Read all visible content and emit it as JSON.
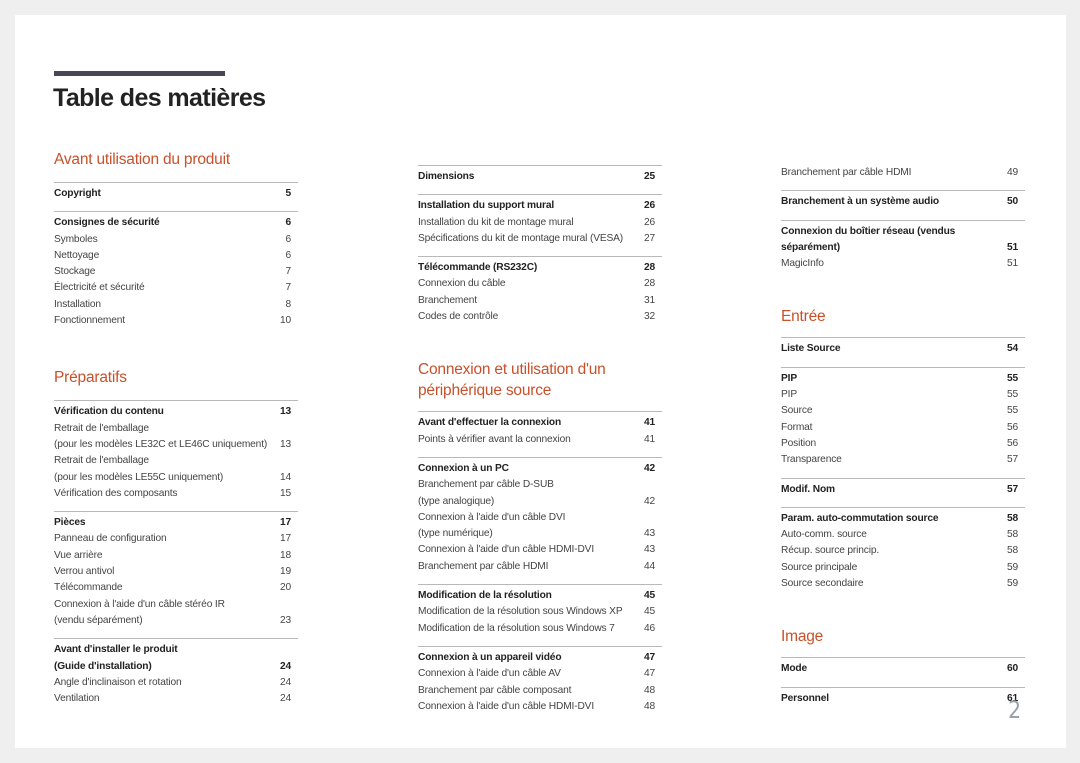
{
  "page_title": "Table des matières",
  "page_number": "2",
  "colors": {
    "heading_accent": "#c8502a",
    "title_bar": "#4a4656"
  },
  "columns": [
    {
      "sections": [
        {
          "heading": "Avant utilisation du produit",
          "groups": [
            {
              "items": [
                {
                  "label": "Copyright",
                  "page": "5",
                  "main": true
                }
              ]
            },
            {
              "items": [
                {
                  "label": "Consignes de sécurité",
                  "page": "6",
                  "main": true
                },
                {
                  "label": "Symboles",
                  "page": "6"
                },
                {
                  "label": "Nettoyage",
                  "page": "6"
                },
                {
                  "label": "Stockage",
                  "page": "7"
                },
                {
                  "label": "Électricité et sécurité",
                  "page": "7"
                },
                {
                  "label": "Installation",
                  "page": "8"
                },
                {
                  "label": "Fonctionnement",
                  "page": "10"
                }
              ]
            }
          ]
        },
        {
          "heading": "Préparatifs",
          "groups": [
            {
              "items": [
                {
                  "label": "Vérification du contenu",
                  "page": "13",
                  "main": true
                },
                {
                  "label": "Retrait de l'emballage\n(pour les modèles LE32C et LE46C uniquement)",
                  "page": "13"
                },
                {
                  "label": "Retrait de l'emballage\n(pour les modèles LE55C uniquement)",
                  "page": "14"
                },
                {
                  "label": "Vérification des composants",
                  "page": "15"
                }
              ]
            },
            {
              "items": [
                {
                  "label": "Pièces",
                  "page": "17",
                  "main": true
                },
                {
                  "label": "Panneau de configuration",
                  "page": "17"
                },
                {
                  "label": "Vue arrière",
                  "page": "18"
                },
                {
                  "label": "Verrou antivol",
                  "page": "19"
                },
                {
                  "label": "Télécommande",
                  "page": "20"
                },
                {
                  "label": "Connexion à l'aide d'un câble stéréo IR\n(vendu séparément)",
                  "page": "23"
                }
              ]
            },
            {
              "items": [
                {
                  "label": "Avant d'installer le produit\n(Guide d'installation)",
                  "page": "24",
                  "main": true
                },
                {
                  "label": "Angle d'inclinaison et rotation",
                  "page": "24"
                },
                {
                  "label": "Ventilation",
                  "page": "24"
                }
              ]
            }
          ]
        }
      ]
    },
    {
      "sections": [
        {
          "heading": "",
          "groups": [
            {
              "items": [
                {
                  "label": "Dimensions",
                  "page": "25",
                  "main": true
                }
              ]
            },
            {
              "items": [
                {
                  "label": "Installation du support mural",
                  "page": "26",
                  "main": true
                },
                {
                  "label": "Installation du kit de montage mural",
                  "page": "26"
                },
                {
                  "label": "Spécifications du kit de montage mural (VESA)",
                  "page": "27"
                }
              ]
            },
            {
              "items": [
                {
                  "label": "Télécommande (RS232C)",
                  "page": "28",
                  "main": true
                },
                {
                  "label": "Connexion du câble",
                  "page": "28"
                },
                {
                  "label": "Branchement",
                  "page": "31"
                },
                {
                  "label": "Codes de contrôle",
                  "page": "32"
                }
              ]
            }
          ]
        },
        {
          "heading": "Connexion et utilisation d'un\npériphérique source",
          "groups": [
            {
              "items": [
                {
                  "label": "Avant d'effectuer la connexion",
                  "page": "41",
                  "main": true
                },
                {
                  "label": "Points à vérifier avant la connexion",
                  "page": "41"
                }
              ]
            },
            {
              "items": [
                {
                  "label": "Connexion à un PC",
                  "page": "42",
                  "main": true
                },
                {
                  "label": "Branchement par câble D-SUB\n(type analogique)",
                  "page": "42"
                },
                {
                  "label": "Connexion à l'aide d'un câble DVI\n(type numérique)",
                  "page": "43"
                },
                {
                  "label": "Connexion à l'aide d'un câble HDMI-DVI",
                  "page": "43"
                },
                {
                  "label": "Branchement par câble HDMI",
                  "page": "44"
                }
              ]
            },
            {
              "items": [
                {
                  "label": "Modification de la résolution",
                  "page": "45",
                  "main": true
                },
                {
                  "label": "Modification de la résolution sous Windows XP",
                  "page": "45"
                },
                {
                  "label": "Modification de la résolution sous Windows 7",
                  "page": "46"
                }
              ]
            },
            {
              "items": [
                {
                  "label": "Connexion à un appareil vidéo",
                  "page": "47",
                  "main": true
                },
                {
                  "label": "Connexion à l'aide d'un câble AV",
                  "page": "47"
                },
                {
                  "label": "Branchement par câble composant",
                  "page": "48"
                },
                {
                  "label": "Connexion à l'aide d'un câble HDMI-DVI",
                  "page": "48"
                }
              ]
            }
          ]
        }
      ]
    },
    {
      "sections": [
        {
          "heading": "",
          "groups": [
            {
              "noborder": true,
              "items": [
                {
                  "label": "Branchement par câble HDMI",
                  "page": "49"
                }
              ]
            },
            {
              "items": [
                {
                  "label": "Branchement à un système audio",
                  "page": "50",
                  "main": true
                }
              ]
            },
            {
              "items": [
                {
                  "label": "Connexion du boîtier réseau (vendus\nséparément)",
                  "page": "51",
                  "main": true
                },
                {
                  "label": "MagicInfo",
                  "page": "51"
                }
              ]
            }
          ]
        },
        {
          "heading": "Entrée",
          "groups": [
            {
              "items": [
                {
                  "label": "Liste Source",
                  "page": "54",
                  "main": true
                }
              ]
            },
            {
              "items": [
                {
                  "label": "PIP",
                  "page": "55",
                  "main": true
                },
                {
                  "label": "PIP",
                  "page": "55"
                },
                {
                  "label": "Source",
                  "page": "55"
                },
                {
                  "label": "Format",
                  "page": "56"
                },
                {
                  "label": "Position",
                  "page": "56"
                },
                {
                  "label": "Transparence",
                  "page": "57"
                }
              ]
            },
            {
              "items": [
                {
                  "label": "Modif. Nom",
                  "page": "57",
                  "main": true
                }
              ]
            },
            {
              "items": [
                {
                  "label": "Param. auto-commutation source",
                  "page": "58",
                  "main": true
                },
                {
                  "label": "Auto-comm. source",
                  "page": "58"
                },
                {
                  "label": "Récup. source princip.",
                  "page": "58"
                },
                {
                  "label": "Source principale",
                  "page": "59"
                },
                {
                  "label": "Source secondaire",
                  "page": "59"
                }
              ]
            }
          ]
        },
        {
          "heading": "Image",
          "groups": [
            {
              "items": [
                {
                  "label": "Mode",
                  "page": "60",
                  "main": true
                }
              ]
            },
            {
              "items": [
                {
                  "label": "Personnel",
                  "page": "61",
                  "main": true
                }
              ]
            }
          ]
        }
      ]
    }
  ]
}
